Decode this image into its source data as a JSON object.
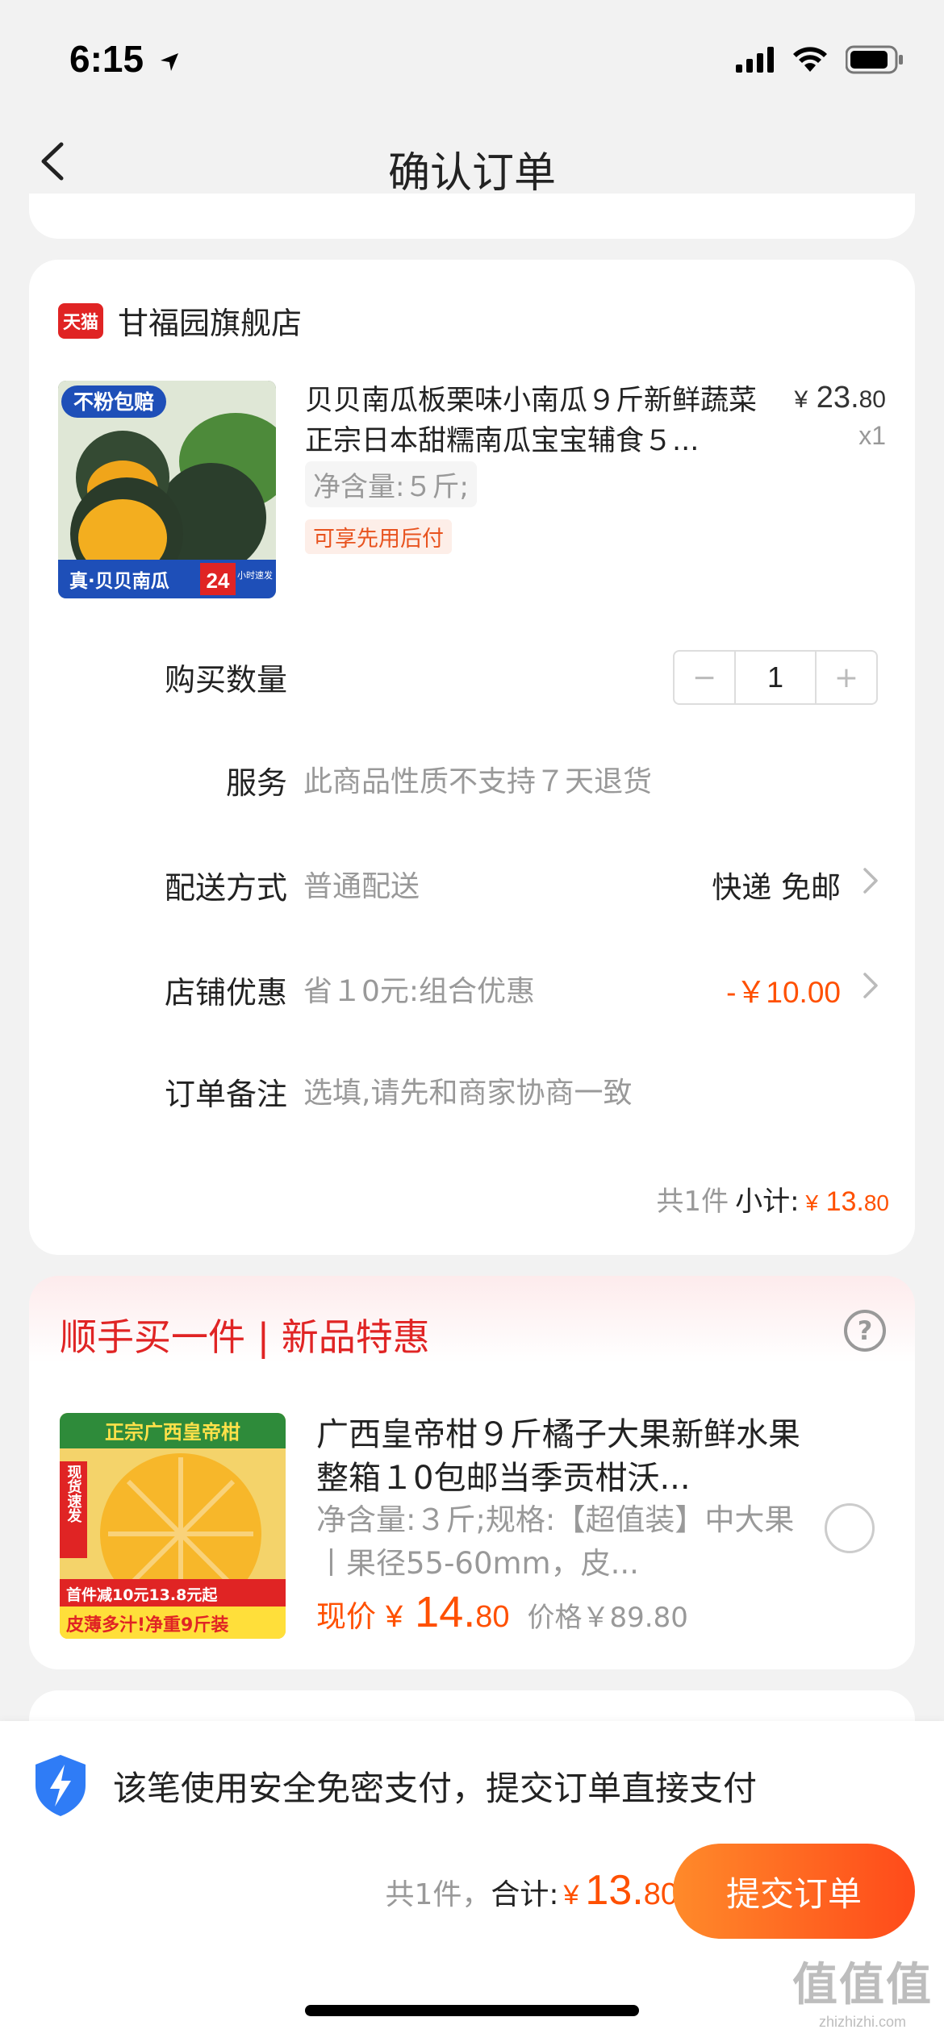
{
  "status_bar": {
    "time": "6:15"
  },
  "nav": {
    "title": "确认订单"
  },
  "shop": {
    "badge": "天猫",
    "name": "甘福园旗舰店"
  },
  "product": {
    "title": "贝贝南瓜板栗味小南瓜９斤新鲜蔬菜正宗日本甜糯南瓜宝宝辅食５...",
    "price_symbol": "¥",
    "price_int": "23.",
    "price_cents": "80",
    "quantity_label": "x1",
    "spec": "净含量:５斤;",
    "tag": "可享先用后付",
    "image_texts": {
      "top": "不粉包赔",
      "bottom": "真·贝贝南瓜",
      "badge_num": "24",
      "badge_text": "小时速发"
    }
  },
  "rows": {
    "quantity": {
      "label": "购买数量",
      "value": "1",
      "minus": "−",
      "plus": "+"
    },
    "service": {
      "label": "服务",
      "value": "此商品性质不支持７天退货"
    },
    "delivery": {
      "label": "配送方式",
      "value": "普通配送",
      "right": "快递 免邮"
    },
    "discount": {
      "label": "店铺优惠",
      "value": "省１0元:组合优惠",
      "right": "-￥10.00"
    },
    "note": {
      "label": "订单备注",
      "placeholder": "选填,请先和商家协商一致"
    }
  },
  "subtotal": {
    "count": "共1件",
    "label": "小计:",
    "currency": "¥",
    "amount_int": "13.",
    "amount_cents": "80"
  },
  "addon": {
    "title": "顺手买一件 | 新品特惠",
    "help": "?",
    "name": "广西皇帝柑９斤橘子大果新鲜水果整箱１0包邮当季贡柑沃...",
    "spec": "净含量:３斤;规格:【超值装】中大果丨果径55-60mm，皮...",
    "price_label": "现价",
    "price_currency": "¥",
    "price_int": "14.",
    "price_cents": "80",
    "orig_price": "价格￥89.80",
    "image_texts": {
      "top": "正宗广西皇帝柑",
      "side": "现货速发",
      "promo": "首件减10元13.8元起",
      "bottom": "皮薄多汁!净重9斤装"
    }
  },
  "bottom": {
    "secure_text": "该笔使用安全免密支付，提交订单直接支付",
    "count": "共1件，",
    "total_label": "合计:",
    "currency": "¥",
    "amount_int": "13.",
    "amount_cents": "80",
    "submit": "提交订单"
  },
  "watermark": {
    "big": "值值值",
    "small": "zhizhizhi.com"
  },
  "colors": {
    "accent": "#ff5000",
    "tmall_red": "#e02424",
    "shield_blue": "#2f7cf6"
  }
}
